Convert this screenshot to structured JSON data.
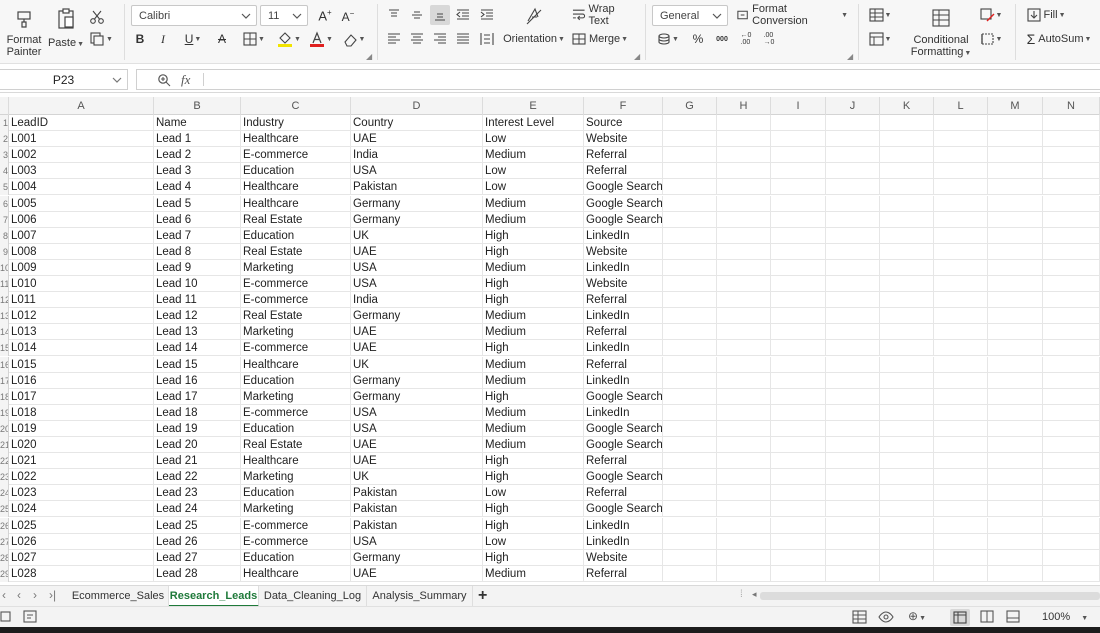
{
  "ribbon": {
    "format_painter": "Format\nPainter",
    "format_painter_l1": "Format",
    "format_painter_l2": "Painter",
    "paste": "Paste",
    "font_name": "Calibri",
    "font_size": "11",
    "wrap_text": "Wrap Text",
    "orientation": "Orientation",
    "merge": "Merge",
    "number_format": "General",
    "format_conversion": "Format Conversion",
    "conditional_formatting_l1": "Conditional",
    "conditional_formatting_l2": "Formatting",
    "fill": "Fill",
    "autosum": "AutoSum",
    "font_color": "#e0201f",
    "highlight_color": "#f2e400"
  },
  "formula_bar": {
    "name_box": "P23",
    "fx": "fx",
    "formula": ""
  },
  "columns": [
    "A",
    "B",
    "C",
    "D",
    "E",
    "F",
    "G",
    "H",
    "I",
    "J",
    "K",
    "L",
    "M",
    "N"
  ],
  "row_numbers": [
    "1",
    "2",
    "3",
    "4",
    "5",
    "6",
    "7",
    "8",
    "9",
    "10",
    "11",
    "12",
    "13",
    "14",
    "15",
    "16",
    "17",
    "18",
    "19",
    "20",
    "21",
    "22",
    "23",
    "24",
    "25",
    "26",
    "27",
    "28",
    "29"
  ],
  "headers": [
    "LeadID",
    "Name",
    "Industry",
    "Country",
    "Interest Level",
    "Source"
  ],
  "rows": [
    [
      "L001",
      "Lead 1",
      "Healthcare",
      "UAE",
      "Low",
      "Website"
    ],
    [
      "L002",
      "Lead 2",
      "E-commerce",
      "India",
      "Medium",
      "Referral"
    ],
    [
      "L003",
      "Lead 3",
      "Education",
      "USA",
      "Low",
      "Referral"
    ],
    [
      "L004",
      "Lead 4",
      "Healthcare",
      "Pakistan",
      "Low",
      "Google Search"
    ],
    [
      "L005",
      "Lead 5",
      "Healthcare",
      "Germany",
      "Medium",
      "Google Search"
    ],
    [
      "L006",
      "Lead 6",
      "Real Estate",
      "Germany",
      "Medium",
      "Google Search"
    ],
    [
      "L007",
      "Lead 7",
      "Education",
      "UK",
      "High",
      "LinkedIn"
    ],
    [
      "L008",
      "Lead 8",
      "Real Estate",
      "UAE",
      "High",
      "Website"
    ],
    [
      "L009",
      "Lead 9",
      "Marketing",
      "USA",
      "Medium",
      "LinkedIn"
    ],
    [
      "L010",
      "Lead 10",
      "E-commerce",
      "USA",
      "High",
      "Website"
    ],
    [
      "L011",
      "Lead 11",
      "E-commerce",
      "India",
      "High",
      "Referral"
    ],
    [
      "L012",
      "Lead 12",
      "Real Estate",
      "Germany",
      "Medium",
      "LinkedIn"
    ],
    [
      "L013",
      "Lead 13",
      "Marketing",
      "UAE",
      "Medium",
      "Referral"
    ],
    [
      "L014",
      "Lead 14",
      "E-commerce",
      "UAE",
      "High",
      "LinkedIn"
    ],
    [
      "L015",
      "Lead 15",
      "Healthcare",
      "UK",
      "Medium",
      "Referral"
    ],
    [
      "L016",
      "Lead 16",
      "Education",
      "Germany",
      "Medium",
      "LinkedIn"
    ],
    [
      "L017",
      "Lead 17",
      "Marketing",
      "Germany",
      "High",
      "Google Search"
    ],
    [
      "L018",
      "Lead 18",
      "E-commerce",
      "USA",
      "Medium",
      "LinkedIn"
    ],
    [
      "L019",
      "Lead 19",
      "Education",
      "USA",
      "Medium",
      "Google Search"
    ],
    [
      "L020",
      "Lead 20",
      "Real Estate",
      "UAE",
      "Medium",
      "Google Search"
    ],
    [
      "L021",
      "Lead 21",
      "Healthcare",
      "UAE",
      "High",
      "Referral"
    ],
    [
      "L022",
      "Lead 22",
      "Marketing",
      "UK",
      "High",
      "Google Search"
    ],
    [
      "L023",
      "Lead 23",
      "Education",
      "Pakistan",
      "Low",
      "Referral"
    ],
    [
      "L024",
      "Lead 24",
      "Marketing",
      "Pakistan",
      "High",
      "Google Search"
    ],
    [
      "L025",
      "Lead 25",
      "E-commerce",
      "Pakistan",
      "High",
      "LinkedIn"
    ],
    [
      "L026",
      "Lead 26",
      "E-commerce",
      "USA",
      "Low",
      "LinkedIn"
    ],
    [
      "L027",
      "Lead 27",
      "Education",
      "Germany",
      "High",
      "Website"
    ],
    [
      "L028",
      "Lead 28",
      "Healthcare",
      "UAE",
      "Medium",
      "Referral"
    ]
  ],
  "sheet_tabs": [
    {
      "label": "Ecommerce_Sales",
      "active": false
    },
    {
      "label": "Research_Leads",
      "active": true
    },
    {
      "label": "Data_Cleaning_Log",
      "active": false
    },
    {
      "label": "Analysis_Summary",
      "active": false
    }
  ],
  "add_sheet": "+",
  "status": {
    "zoom": "100%"
  }
}
